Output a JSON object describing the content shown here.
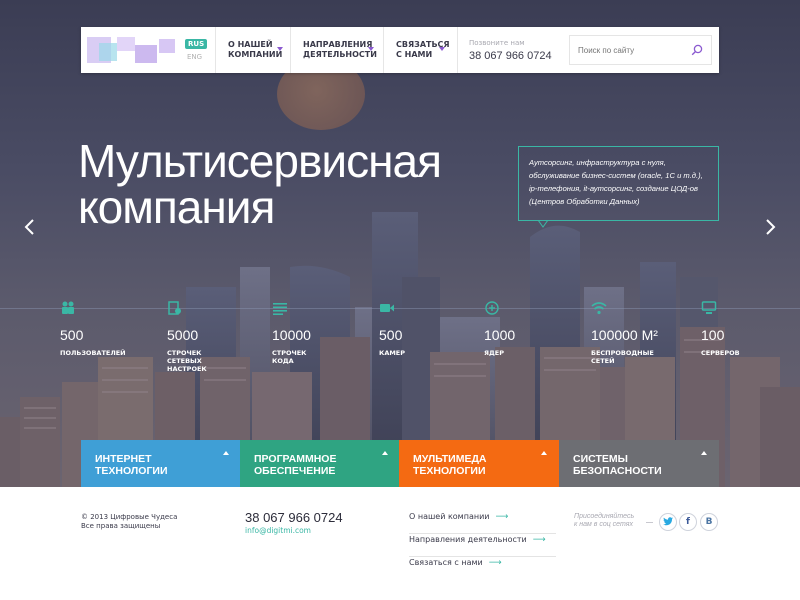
{
  "header": {
    "lang_active": "RUS",
    "lang_other": "ENG",
    "nav": [
      {
        "label": "О НАШЕЙ\nКОМПАНИИ"
      },
      {
        "label": "НАПРАВЛЕНИЯ\nДЕЯТЕЛЬНОСТИ"
      },
      {
        "label": "СВЯЗАТЬСЯ\nС НАМИ"
      }
    ],
    "call_label": "Позвоните нам",
    "call_phone": "38 067 966 0724",
    "search_placeholder": "Поиск по сайту"
  },
  "hero": {
    "headline_line1": "Мультисервисная",
    "headline_line2": "компания",
    "bubble_text": "Аутсорсинг, инфраструктура с нуля, обслуживание бизнес-систем (oracle, 1С и т.д.), ip-телефония, it-аутсорсинг, создание ЦОД-ов (Центров Обработки Данных)"
  },
  "stats": [
    {
      "icon": "users-icon",
      "value": "500",
      "label": "ПОЛЬЗОВАТЕЛЕЙ"
    },
    {
      "icon": "network-settings-icon",
      "value": "5000",
      "label": "СТРОЧЕК\nСЕТЕВЫХ\nНАСТРОЕК"
    },
    {
      "icon": "code-lines-icon",
      "value": "10000",
      "label": "СТРОЧЕК\nКОДА"
    },
    {
      "icon": "camera-icon",
      "value": "500",
      "label": "КАМЕР"
    },
    {
      "icon": "core-icon",
      "value": "1000",
      "label": "ЯДЕР"
    },
    {
      "icon": "wifi-icon",
      "value": "100000 М²",
      "label": "БЕСПРОВОДНЫЕ\nСЕТЕЙ"
    },
    {
      "icon": "server-icon",
      "value": "100",
      "label": "СЕРВЕРОВ"
    }
  ],
  "services": [
    {
      "line1": "ИНТЕРНЕТ",
      "line2": "ТЕХНОЛОГИИ",
      "color": "#3f9fd6"
    },
    {
      "line1": "ПРОГРАММНОЕ",
      "line2": "ОБЕСПЕЧЕНИЕ",
      "color": "#2fa482"
    },
    {
      "line1": "МУЛЬТИМЕДА",
      "line2": "ТЕХНОЛОГИИ",
      "color": "#f46a12"
    },
    {
      "line1": "СИСТЕМЫ",
      "line2": "БЕЗОПАСНОСТИ",
      "color": "#6d6e73"
    }
  ],
  "footer": {
    "copyright_line1": "© 2013 Цифровые Чудеса",
    "copyright_line2": "Все права защищены",
    "phone": "38 067 966 0724",
    "email": "info@digitmi.com",
    "links": [
      "О нашей компании",
      "Направления деятельности",
      "Связаться с нами"
    ],
    "social_line1": "Присоединяйтесь",
    "social_line2": "к нам в соц сетях",
    "social": [
      {
        "name": "twitter-icon",
        "glyph": "🐦",
        "color": "#29a9e1"
      },
      {
        "name": "facebook-icon",
        "glyph": "f",
        "color": "#3b5998"
      },
      {
        "name": "vkontakte-icon",
        "glyph": "В",
        "color": "#4c75a3"
      }
    ]
  },
  "colors": {
    "accent": "#3ab7a5",
    "purple": "#8b5ad0"
  }
}
